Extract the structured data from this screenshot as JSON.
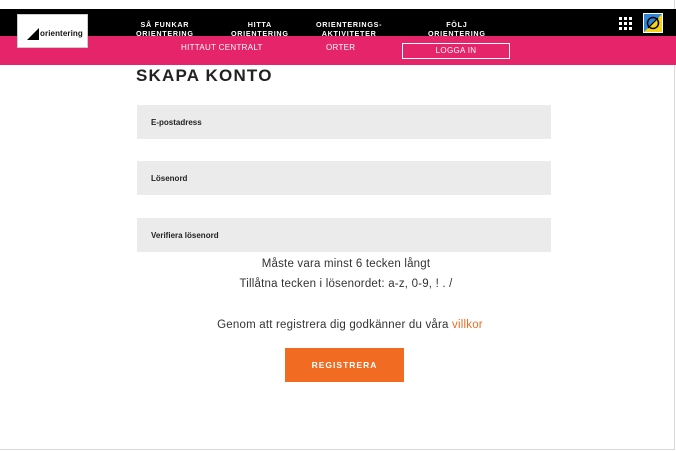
{
  "logo": {
    "text": "orientering"
  },
  "nav": {
    "items": [
      {
        "line1": "SÅ FUNKAR",
        "line2": "ORIENTERING"
      },
      {
        "line1": "HITTA",
        "line2": "ORIENTERING"
      },
      {
        "line1": "ORIENTERINGS-",
        "line2": "AKTIVITETER"
      },
      {
        "line1": "FÖLJ",
        "line2": "ORIENTERING"
      }
    ]
  },
  "subnav": {
    "hittaut": "HITTAUT CENTRALT",
    "orter": "ORTER",
    "login": "LOGGA IN"
  },
  "form": {
    "title": "SKAPA KONTO",
    "email_label": "E-postadress",
    "password_label": "Lösenord",
    "verify_label": "Verifiera lösenord",
    "hint1": "Måste vara minst 6 tecken långt",
    "hint2": "Tillåtna tecken i lösenordet: a-z, 0-9, ! . /",
    "terms_prefix": "Genom att registrera dig godkänner du våra ",
    "terms_link": "villkor",
    "submit": "REGISTRERA"
  },
  "colors": {
    "pink": "#e6246a",
    "orange": "#f26b22",
    "field": "#ebebeb"
  },
  "icons": [
    "apps-grid-icon",
    "compass-logo-icon"
  ]
}
